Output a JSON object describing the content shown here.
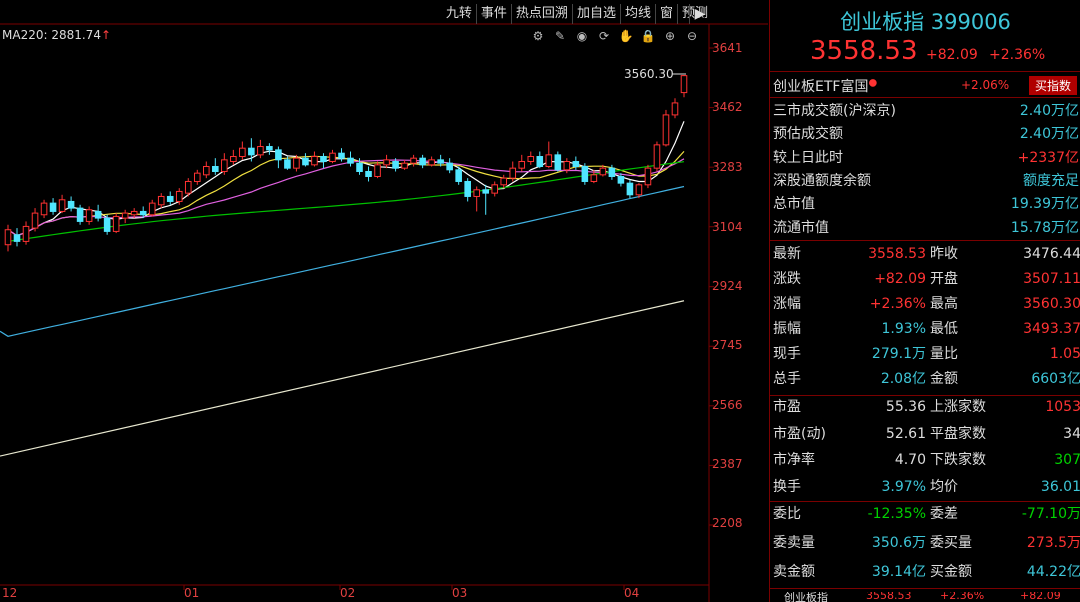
{
  "toolbar": {
    "items": [
      "九转",
      "事件",
      "热点回溯",
      "加自选",
      "均线",
      "窗",
      "预测"
    ],
    "end_icon": "collapse-right-icon"
  },
  "chart": {
    "ma_label": "MA220: 2881.74",
    "ma_arrow": "↑",
    "high_label": "3560.30",
    "y_ticks": [
      "3641",
      "3462",
      "3283",
      "3104",
      "2924",
      "2745",
      "2566",
      "2387",
      "2208"
    ],
    "x_ticks": [
      "12",
      "01",
      "02",
      "03",
      "04"
    ],
    "icons": [
      "settings-icon",
      "pen-icon",
      "eye-icon",
      "cycle-icon",
      "hand-icon",
      "lock-icon",
      "zoom-in-icon",
      "zoom-out-icon"
    ]
  },
  "chart_data": {
    "type": "candlestick",
    "title": "",
    "ylim": [
      2208,
      3641
    ],
    "categories": [
      "12",
      "01",
      "02",
      "03",
      "04"
    ],
    "candles": [
      [
        3050,
        3095,
        3030,
        3110
      ],
      [
        3080,
        3060,
        3045,
        3100
      ],
      [
        3060,
        3105,
        3050,
        3120
      ],
      [
        3100,
        3145,
        3090,
        3160
      ],
      [
        3140,
        3175,
        3130,
        3185
      ],
      [
        3175,
        3150,
        3140,
        3190
      ],
      [
        3150,
        3185,
        3145,
        3200
      ],
      [
        3180,
        3160,
        3150,
        3195
      ],
      [
        3160,
        3120,
        3110,
        3170
      ],
      [
        3120,
        3155,
        3110,
        3165
      ],
      [
        3150,
        3130,
        3120,
        3170
      ],
      [
        3130,
        3090,
        3080,
        3140
      ],
      [
        3090,
        3135,
        3085,
        3145
      ],
      [
        3130,
        3145,
        3115,
        3155
      ],
      [
        3140,
        3150,
        3130,
        3160
      ],
      [
        3150,
        3140,
        3130,
        3165
      ],
      [
        3140,
        3175,
        3135,
        3185
      ],
      [
        3170,
        3195,
        3160,
        3205
      ],
      [
        3195,
        3180,
        3170,
        3210
      ],
      [
        3180,
        3210,
        3170,
        3220
      ],
      [
        3205,
        3240,
        3195,
        3250
      ],
      [
        3240,
        3265,
        3230,
        3275
      ],
      [
        3260,
        3285,
        3250,
        3300
      ],
      [
        3285,
        3270,
        3260,
        3310
      ],
      [
        3270,
        3305,
        3260,
        3325
      ],
      [
        3300,
        3315,
        3290,
        3335
      ],
      [
        3315,
        3340,
        3305,
        3360
      ],
      [
        3340,
        3320,
        3300,
        3370
      ],
      [
        3320,
        3345,
        3310,
        3365
      ],
      [
        3345,
        3335,
        3320,
        3355
      ],
      [
        3335,
        3305,
        3280,
        3345
      ],
      [
        3305,
        3280,
        3275,
        3315
      ],
      [
        3280,
        3310,
        3270,
        3320
      ],
      [
        3310,
        3290,
        3285,
        3325
      ],
      [
        3290,
        3315,
        3285,
        3330
      ],
      [
        3315,
        3300,
        3280,
        3325
      ],
      [
        3300,
        3325,
        3295,
        3335
      ],
      [
        3325,
        3310,
        3300,
        3340
      ],
      [
        3310,
        3295,
        3285,
        3330
      ],
      [
        3295,
        3270,
        3260,
        3310
      ],
      [
        3270,
        3255,
        3240,
        3285
      ],
      [
        3255,
        3290,
        3250,
        3300
      ],
      [
        3290,
        3305,
        3280,
        3320
      ],
      [
        3300,
        3280,
        3270,
        3310
      ],
      [
        3280,
        3295,
        3275,
        3305
      ],
      [
        3295,
        3310,
        3285,
        3320
      ],
      [
        3310,
        3290,
        3280,
        3320
      ],
      [
        3290,
        3305,
        3285,
        3315
      ],
      [
        3305,
        3295,
        3285,
        3320
      ],
      [
        3295,
        3275,
        3265,
        3310
      ],
      [
        3275,
        3240,
        3230,
        3285
      ],
      [
        3240,
        3195,
        3180,
        3250
      ],
      [
        3195,
        3215,
        3150,
        3225
      ],
      [
        3215,
        3205,
        3140,
        3230
      ],
      [
        3205,
        3230,
        3195,
        3240
      ],
      [
        3230,
        3250,
        3220,
        3260
      ],
      [
        3250,
        3280,
        3240,
        3300
      ],
      [
        3280,
        3300,
        3270,
        3320
      ],
      [
        3300,
        3315,
        3290,
        3330
      ],
      [
        3315,
        3285,
        3280,
        3330
      ],
      [
        3285,
        3320,
        3280,
        3360
      ],
      [
        3320,
        3275,
        3270,
        3330
      ],
      [
        3275,
        3300,
        3265,
        3310
      ],
      [
        3300,
        3285,
        3275,
        3315
      ],
      [
        3285,
        3240,
        3230,
        3295
      ],
      [
        3240,
        3260,
        3235,
        3275
      ],
      [
        3260,
        3280,
        3255,
        3290
      ],
      [
        3280,
        3255,
        3245,
        3290
      ],
      [
        3255,
        3235,
        3225,
        3265
      ],
      [
        3235,
        3200,
        3190,
        3245
      ],
      [
        3200,
        3230,
        3190,
        3235
      ],
      [
        3230,
        3280,
        3220,
        3290
      ],
      [
        3280,
        3350,
        3270,
        3360
      ],
      [
        3350,
        3440,
        3345,
        3455
      ],
      [
        3440,
        3476,
        3430,
        3490
      ],
      [
        3507,
        3558,
        3493,
        3560
      ]
    ],
    "ma_lines": [
      {
        "name": "MA5",
        "color": "#ffffff"
      },
      {
        "name": "MA10",
        "color": "#f0e040"
      },
      {
        "name": "MA20",
        "color": "#e060e0"
      },
      {
        "name": "MA30",
        "color": "#00c000"
      },
      {
        "name": "MA60",
        "color": "#40b0e0"
      },
      {
        "name": "MA220",
        "color": "#e8e8d0"
      }
    ]
  },
  "panel": {
    "title": "创业板指 399006",
    "price": "3558.53",
    "change": "+82.09",
    "change_pct": "+2.36%",
    "etf": {
      "name": "创业板ETF富国",
      "pct": "+2.06%",
      "button": "买指数"
    },
    "market": [
      {
        "k": "三市成交额(沪深京)",
        "v": "2.40万亿",
        "c": "cyan"
      },
      {
        "k": "预估成交额",
        "v": "2.40万亿",
        "c": "cyan"
      },
      {
        "k": "较上日此时",
        "v": "+2337亿",
        "c": "red"
      },
      {
        "k": "深股通额度余额",
        "v": "额度充足",
        "c": "cyan"
      },
      {
        "k": "总市值",
        "v": "19.39万亿",
        "c": "cyan"
      },
      {
        "k": "流通市值",
        "v": "15.78万亿",
        "c": "cyan"
      }
    ],
    "quote": [
      {
        "k1": "最新",
        "v1": "3558.53",
        "c1": "red",
        "k2": "昨收",
        "v2": "3476.44",
        "c2": "white"
      },
      {
        "k1": "涨跌",
        "v1": "+82.09",
        "c1": "red",
        "k2": "开盘",
        "v2": "3507.11",
        "c2": "red"
      },
      {
        "k1": "涨幅",
        "v1": "+2.36%",
        "c1": "red",
        "k2": "最高",
        "v2": "3560.30",
        "c2": "red"
      },
      {
        "k1": "振幅",
        "v1": "1.93%",
        "c1": "cyan",
        "k2": "最低",
        "v2": "3493.37",
        "c2": "red"
      },
      {
        "k1": "现手",
        "v1": "279.1万",
        "c1": "cyan",
        "k2": "量比",
        "v2": "1.05",
        "c2": "red"
      },
      {
        "k1": "总手",
        "v1": "2.08亿",
        "c1": "cyan",
        "k2": "金额",
        "v2": "6603亿",
        "c2": "cyan"
      }
    ],
    "stats": [
      {
        "k1": "市盈",
        "v1": "55.36",
        "c1": "white",
        "k2": "上涨家数",
        "v2": "1053",
        "c2": "red"
      },
      {
        "k1": "市盈(动)",
        "v1": "52.61",
        "c1": "white",
        "k2": "平盘家数",
        "v2": "34",
        "c2": "white"
      },
      {
        "k1": "市净率",
        "v1": "4.70",
        "c1": "white",
        "k2": "下跌家数",
        "v2": "307",
        "c2": "green"
      },
      {
        "k1": "换手",
        "v1": "3.97%",
        "c1": "cyan",
        "k2": "均价",
        "v2": "36.01",
        "c2": "cyan"
      }
    ],
    "order": [
      {
        "k1": "委比",
        "v1": "-12.35%",
        "c1": "green",
        "k2": "委差",
        "v2": "-77.10万",
        "c2": "green"
      },
      {
        "k1": "委卖量",
        "v1": "350.6万",
        "c1": "cyan",
        "k2": "委买量",
        "v2": "273.5万",
        "c2": "red"
      },
      {
        "k1": "卖金额",
        "v1": "39.14亿",
        "c1": "cyan",
        "k2": "买金额",
        "v2": "44.22亿",
        "c2": "cyan"
      }
    ],
    "bottom": {
      "name": "创业板指",
      "price": "3558.53",
      "pct": "+2.36%",
      "chg": "+82.09"
    }
  }
}
